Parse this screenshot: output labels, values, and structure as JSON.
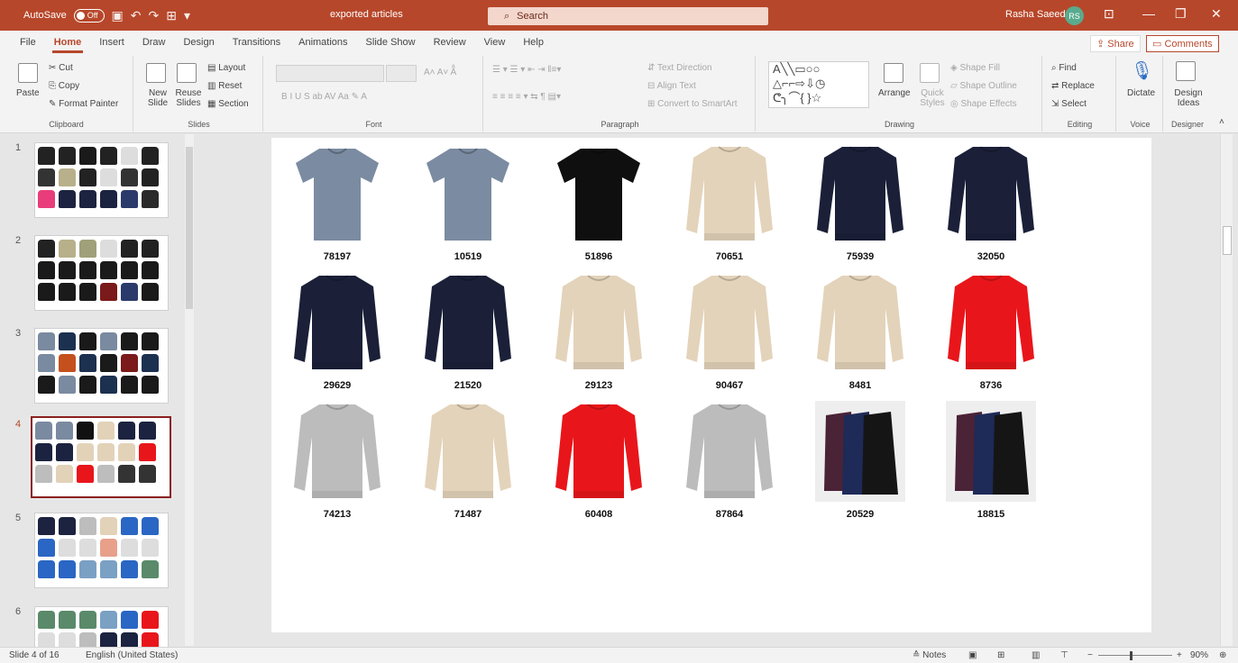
{
  "titlebar": {
    "autosave_label": "AutoSave",
    "autosave_state": "Off",
    "doc_title": "exported articles",
    "search_placeholder": "Search",
    "user_name": "Rasha Saeed",
    "user_initials": "RS"
  },
  "menu": {
    "tabs": [
      "File",
      "Home",
      "Insert",
      "Draw",
      "Design",
      "Transitions",
      "Animations",
      "Slide Show",
      "Review",
      "View",
      "Help"
    ],
    "active": "Home",
    "share": "Share",
    "comments": "Comments"
  },
  "ribbon": {
    "clipboard": {
      "label": "Clipboard",
      "paste": "Paste",
      "cut": "Cut",
      "copy": "Copy",
      "format_painter": "Format Painter"
    },
    "slides": {
      "label": "Slides",
      "new_slide": "New Slide",
      "reuse_slides": "Reuse Slides",
      "layout": "Layout",
      "reset": "Reset",
      "section": "Section"
    },
    "font": {
      "label": "Font"
    },
    "paragraph": {
      "label": "Paragraph",
      "text_direction": "Text Direction",
      "align_text": "Align Text",
      "convert_smartart": "Convert to SmartArt"
    },
    "drawing": {
      "label": "Drawing",
      "arrange": "Arrange",
      "quick_styles": "Quick Styles",
      "shape_fill": "Shape Fill",
      "shape_outline": "Shape Outline",
      "shape_effects": "Shape Effects"
    },
    "editing": {
      "label": "Editing",
      "find": "Find",
      "replace": "Replace",
      "select": "Select"
    },
    "voice": {
      "label": "Voice",
      "dictate": "Dictate"
    },
    "designer": {
      "label": "Designer",
      "design_ideas": "Design Ideas"
    }
  },
  "slides_panel": [
    {
      "num": "1",
      "colors": [
        "#222",
        "#222",
        "#1a1a1a",
        "#222",
        "#ddd",
        "#222",
        "#333",
        "#b8b08a",
        "#222",
        "#ddd",
        "#333",
        "#222",
        "#e83d7a",
        "#1c2340",
        "#1c2340",
        "#1c2340",
        "#2a3a6a",
        "#2a2a2a"
      ]
    },
    {
      "num": "2",
      "colors": [
        "#222",
        "#b8b08a",
        "#a0a07a",
        "#ddd",
        "#222",
        "#222",
        "#1a1a1a",
        "#1a1a1a",
        "#1a1a1a",
        "#1a1a1a",
        "#1a1a1a",
        "#1a1a1a",
        "#1a1a1a",
        "#1a1a1a",
        "#1a1a1a",
        "#7a1a1a",
        "#2a3a6a",
        "#1a1a1a"
      ]
    },
    {
      "num": "3",
      "colors": [
        "#7a8aa0",
        "#1c3050",
        "#1a1a1a",
        "#7a8aa0",
        "#1a1a1a",
        "#1a1a1a",
        "#7a8aa0",
        "#c4501e",
        "#1c3050",
        "#1a1a1a",
        "#7a1a1a",
        "#1c3050",
        "#1a1a1a",
        "#7a8aa0",
        "#1a1a1a",
        "#1c3050",
        "#1a1a1a",
        "#1a1a1a"
      ]
    },
    {
      "num": "4",
      "colors": [
        "#7a8aa0",
        "#7a8aa0",
        "#111",
        "#e2d2b8",
        "#1c2340",
        "#1c2340",
        "#1c2340",
        "#1c2340",
        "#e2d2b8",
        "#e2d2b8",
        "#e2d2b8",
        "#e8161b",
        "#bdbdbd",
        "#e2d2b8",
        "#e8161b",
        "#bdbdbd",
        "#333",
        "#333"
      ]
    },
    {
      "num": "5",
      "colors": [
        "#1c2340",
        "#1c2340",
        "#bdbdbd",
        "#e2d2b8",
        "#2a66c4",
        "#2a66c4",
        "#2a66c4",
        "#ddd",
        "#ddd",
        "#e8a08a",
        "#ddd",
        "#ddd",
        "#2a66c4",
        "#2a66c4",
        "#7aa0c4",
        "#7aa0c4",
        "#2a66c4",
        "#5a8a6a"
      ]
    },
    {
      "num": "6",
      "colors": [
        "#5a8a6a",
        "#5a8a6a",
        "#5a8a6a",
        "#7aa0c4",
        "#2a66c4",
        "#e8161b",
        "#ddd",
        "#ddd",
        "#bdbdbd",
        "#1c2340",
        "#1c2340",
        "#e8161b"
      ]
    }
  ],
  "products": [
    {
      "code": "78197",
      "type": "tshirt",
      "color": "#7b8ba1"
    },
    {
      "code": "10519",
      "type": "tshirt",
      "color": "#7b8ba1"
    },
    {
      "code": "51896",
      "type": "tshirt",
      "color": "#0f0f0f"
    },
    {
      "code": "70651",
      "type": "sweater",
      "color": "#e3d3ba"
    },
    {
      "code": "75939",
      "type": "sweater",
      "color": "#1b2038"
    },
    {
      "code": "32050",
      "type": "sweater",
      "color": "#1b2038"
    },
    {
      "code": "29629",
      "type": "sweater",
      "color": "#1b2038"
    },
    {
      "code": "21520",
      "type": "sweater",
      "color": "#1b2038"
    },
    {
      "code": "29123",
      "type": "sweater",
      "color": "#e3d3ba"
    },
    {
      "code": "90467",
      "type": "sweater",
      "color": "#e3d3ba"
    },
    {
      "code": "8481",
      "type": "sweater",
      "color": "#e3d3ba"
    },
    {
      "code": "8736",
      "type": "sweater",
      "color": "#e8161b"
    },
    {
      "code": "74213",
      "type": "sweater",
      "color": "#bcbcbc"
    },
    {
      "code": "71487",
      "type": "sweater",
      "color": "#e3d3ba"
    },
    {
      "code": "60408",
      "type": "sweater",
      "color": "#e8161b"
    },
    {
      "code": "87864",
      "type": "sweater",
      "color": "#bcbcbc"
    },
    {
      "code": "20529",
      "type": "multi",
      "color": "#eeeeee"
    },
    {
      "code": "18815",
      "type": "multi",
      "color": "#eeeeee"
    }
  ],
  "statusbar": {
    "slide_info": "Slide 4 of 16",
    "language": "English (United States)",
    "notes": "Notes",
    "zoom": "90%"
  },
  "accent": "#b7472a"
}
